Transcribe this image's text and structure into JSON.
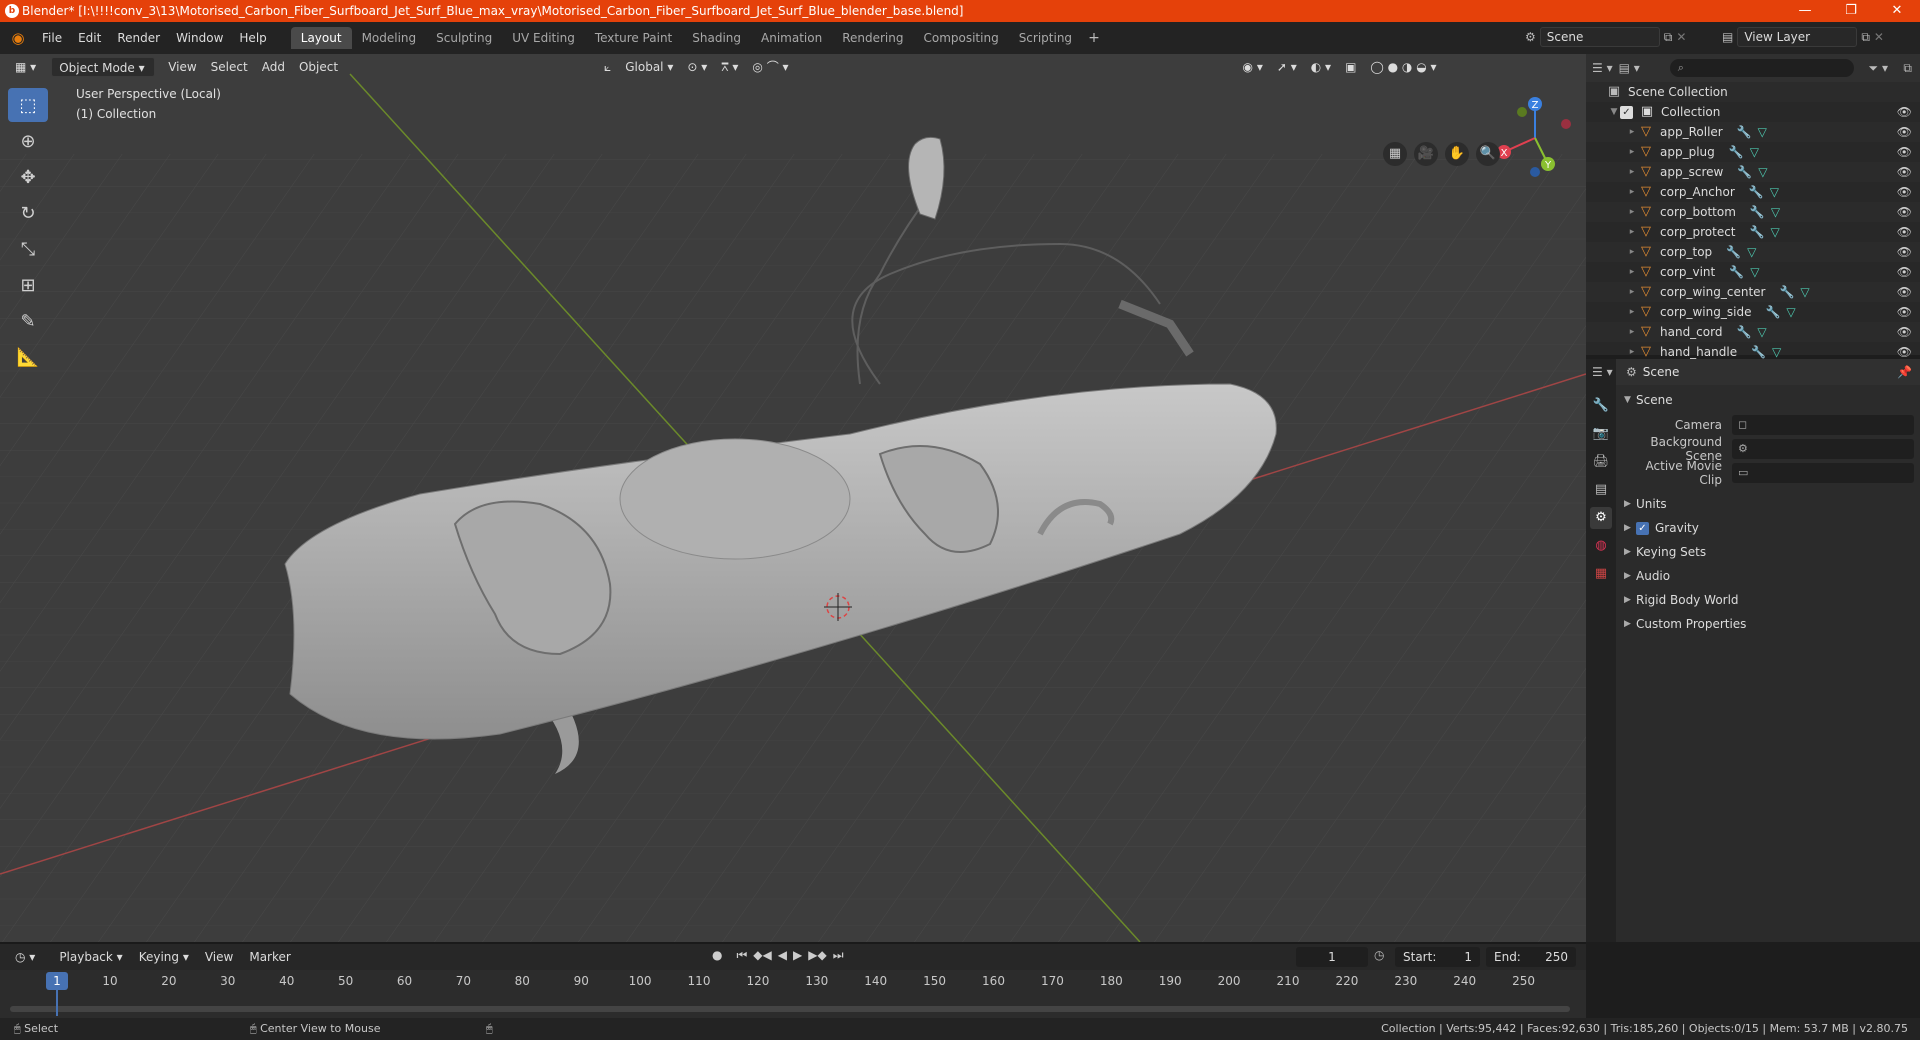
{
  "window": {
    "title": "Blender* [I:\\!!!!conv_3\\13\\Motorised_Carbon_Fiber_Surfboard_Jet_Surf_Blue_max_vray\\Motorised_Carbon_Fiber_Surfboard_Jet_Surf_Blue_blender_base.blend]",
    "minimize": "—",
    "maximize": "❐",
    "close": "✕"
  },
  "menus": [
    "File",
    "Edit",
    "Render",
    "Window",
    "Help"
  ],
  "workspaces": [
    "Layout",
    "Modeling",
    "Sculpting",
    "UV Editing",
    "Texture Paint",
    "Shading",
    "Animation",
    "Rendering",
    "Compositing",
    "Scripting"
  ],
  "active_workspace": "Layout",
  "scene_name": "Scene",
  "view_layer": "View Layer",
  "viewport": {
    "mode": "Object Mode",
    "menus": [
      "View",
      "Select",
      "Add",
      "Object"
    ],
    "orientation": "Global",
    "info_line1": "User Perspective (Local)",
    "info_line2": "(1) Collection",
    "gizmo_x": "X",
    "gizmo_y": "Y",
    "gizmo_z": "Z"
  },
  "outliner": {
    "root": "Scene Collection",
    "collection": "Collection",
    "items": [
      "app_Roller",
      "app_plug",
      "app_screw",
      "corp_Anchor",
      "corp_bottom",
      "corp_protect",
      "corp_top",
      "corp_vint",
      "corp_wing_center",
      "corp_wing_side",
      "hand_cord",
      "hand_handle"
    ]
  },
  "properties": {
    "header": "Scene",
    "section": "Scene",
    "camera_label": "Camera",
    "bg_scene_label": "Background Scene",
    "movie_clip_label": "Active Movie Clip",
    "subsections": [
      "Units",
      "Gravity",
      "Keying Sets",
      "Audio",
      "Rigid Body World",
      "Custom Properties"
    ]
  },
  "timeline": {
    "menus": [
      "Playback",
      "Keying",
      "View",
      "Marker"
    ],
    "current_frame": "1",
    "start_label": "Start:",
    "start": "1",
    "end_label": "End:",
    "end": "250",
    "ticks": [
      "1",
      "10",
      "20",
      "30",
      "40",
      "50",
      "60",
      "70",
      "80",
      "90",
      "100",
      "110",
      "120",
      "130",
      "140",
      "150",
      "160",
      "170",
      "180",
      "190",
      "200",
      "210",
      "220",
      "230",
      "240",
      "250"
    ]
  },
  "status": {
    "left": "Select",
    "middle": "Center View to Mouse",
    "right": "Collection | Verts:95,442 | Faces:92,630 | Tris:185,260 | Objects:0/15 | Mem: 53.7 MB | v2.80.75"
  },
  "colors": {
    "titlebar": "#e5410a",
    "accent": "#4772b3",
    "x_axis": "#e04050",
    "y_axis": "#8ac030",
    "z_axis": "#3a80e0"
  }
}
